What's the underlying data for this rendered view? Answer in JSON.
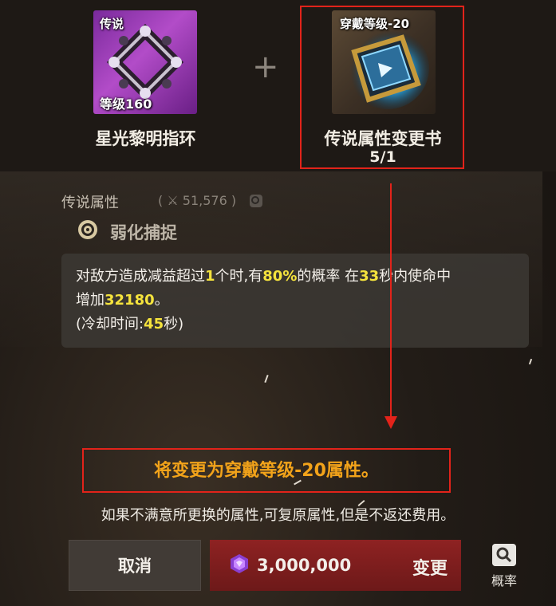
{
  "left_item": {
    "rarity": "传说",
    "level": "等级160",
    "name": "星光黎明指环"
  },
  "plus": "+",
  "right_item": {
    "tag": "穿戴等级-20",
    "name": "传说属性变更书",
    "count": "5/1"
  },
  "attribute": {
    "label": "传说属性",
    "power": "( ⚔ 51,576 )",
    "skill_name": "弱化捕捉"
  },
  "description": {
    "line1_pre": "对敌方造成减益超过",
    "line1_n1": "1",
    "line1_mid": "个时,有",
    "line1_n2": "80%",
    "line1_mid2": "的概率 在",
    "line1_n3": "33",
    "line1_post": "秒内使命中",
    "line2_pre": "增加",
    "line2_n": "32180",
    "line2_post": "。",
    "line3_pre": "(冷却时间:",
    "line3_n": "45",
    "line3_post": "秒)"
  },
  "notice": "将变更为穿戴等级-20属性。",
  "note": "如果不满意所更换的属性,可复原属性,但是不返还费用。",
  "buttons": {
    "cancel": "取消",
    "cost": "3,000,000",
    "change": "变更",
    "probability": "概率"
  },
  "colors": {
    "highlight": "#f5e33d",
    "notice": "#f2a31a",
    "annotation_red": "#e2231a",
    "change_button": "#8e2222"
  },
  "icons": [
    "ring-icon",
    "book-icon",
    "target-icon",
    "gem-icon",
    "search-icon",
    "sword-icon"
  ]
}
